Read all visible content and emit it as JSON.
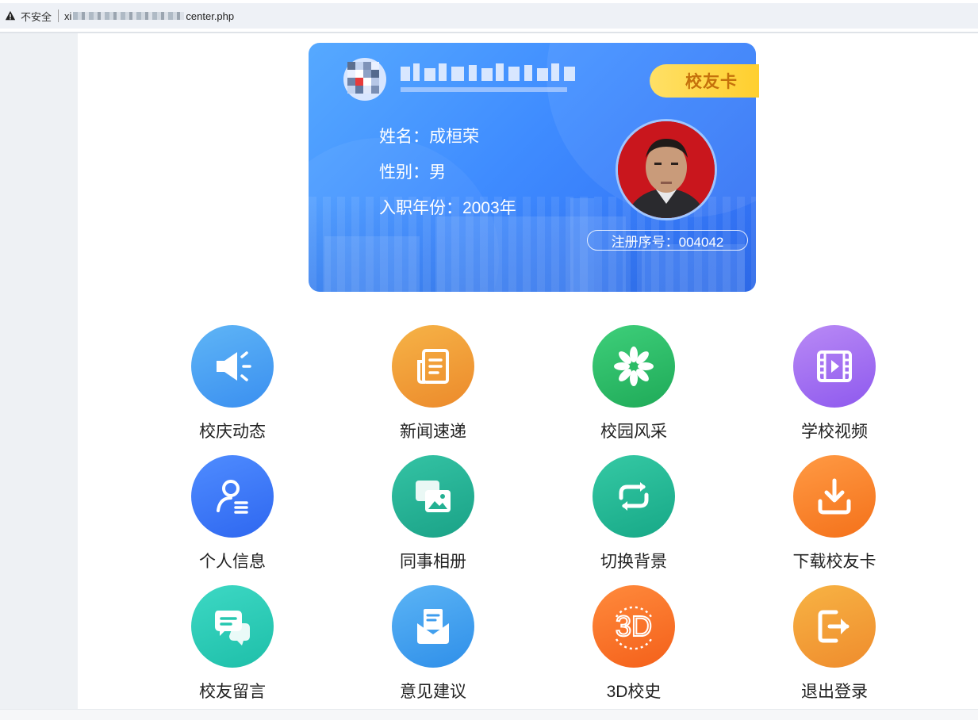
{
  "browser": {
    "security_label": "不安全",
    "url_prefix": "xi",
    "url_suffix": "center.php"
  },
  "card": {
    "badge": "校友卡",
    "name_line": "姓名：成桓荣",
    "gender_line": "性别：男",
    "year_line": "入职年份：2003年",
    "reg_line": "注册序号：004042"
  },
  "menu": [
    {
      "label": "校庆动态",
      "icon": "megaphone-icon",
      "color_from": "#5fb5f6",
      "color_to": "#3a8ff0"
    },
    {
      "label": "新闻速递",
      "icon": "news-icon",
      "color_from": "#f6b347",
      "color_to": "#ec8a2b"
    },
    {
      "label": "校园风采",
      "icon": "flower-icon",
      "color_from": "#3ecf7a",
      "color_to": "#1faa58"
    },
    {
      "label": "学校视频",
      "icon": "video-icon",
      "color_from": "#b98af5",
      "color_to": "#8e59ee"
    },
    {
      "label": "个人信息",
      "icon": "user-icon",
      "color_from": "#4f8cff",
      "color_to": "#2e67f0"
    },
    {
      "label": "同事相册",
      "icon": "album-icon",
      "color_from": "#34c3a4",
      "color_to": "#1aa287"
    },
    {
      "label": "切换背景",
      "icon": "switch-icon",
      "color_from": "#35c9a4",
      "color_to": "#17a887"
    },
    {
      "label": "下载校友卡",
      "icon": "download-icon",
      "color_from": "#ff9a44",
      "color_to": "#f4711a"
    },
    {
      "label": "校友留言",
      "icon": "chat-icon",
      "color_from": "#3dd8c4",
      "color_to": "#1ebfa9"
    },
    {
      "label": "意见建议",
      "icon": "mail-icon",
      "color_from": "#5bb4f5",
      "color_to": "#2f8fe9"
    },
    {
      "label": "3D校史",
      "icon": "3d-icon",
      "color_from": "#ff8a3c",
      "color_to": "#f4601a"
    },
    {
      "label": "退出登录",
      "icon": "logout-icon",
      "color_from": "#f7b344",
      "color_to": "#ef8c2d"
    }
  ]
}
